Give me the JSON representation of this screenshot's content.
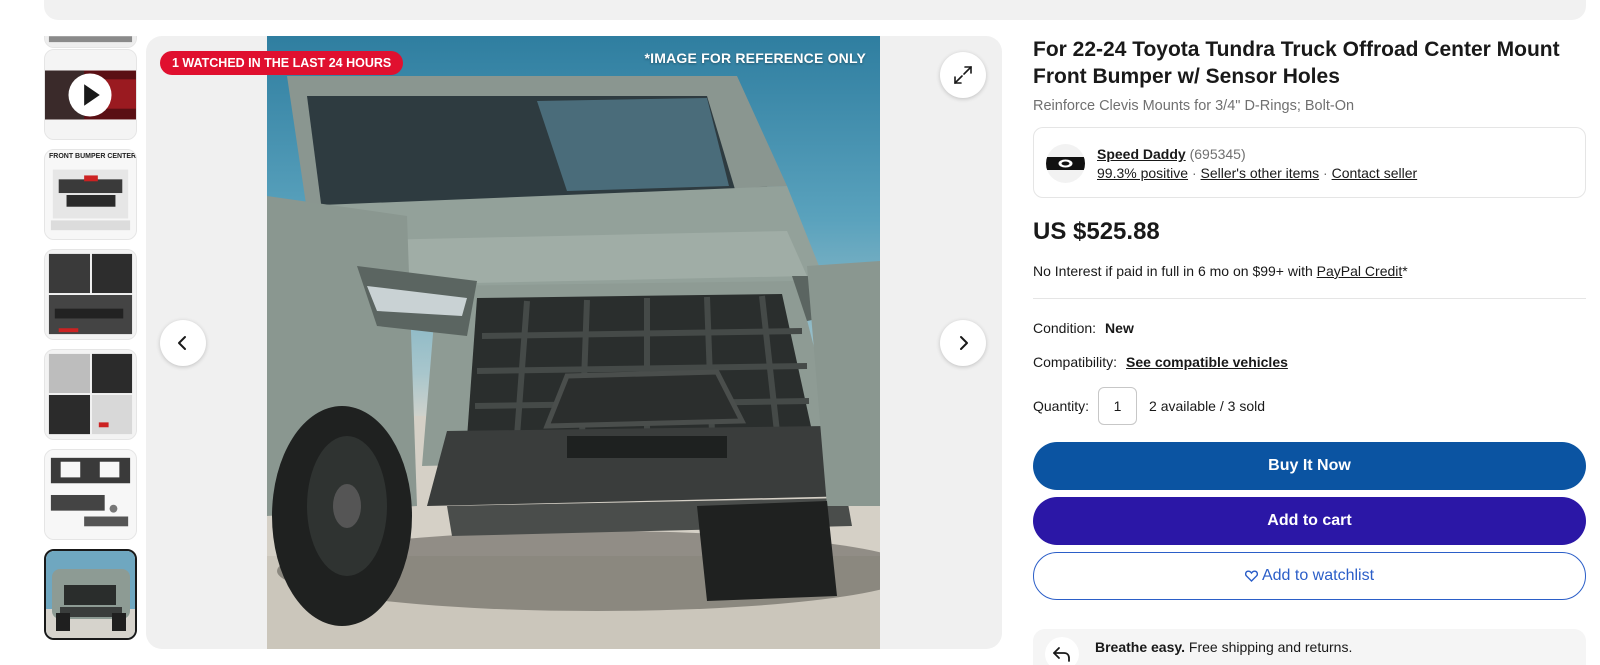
{
  "gallery": {
    "badge": "1 WATCHED IN THE LAST 24 HOURS",
    "watermark": "*IMAGE FOR REFERENCE ONLY",
    "thumbnails": [
      {
        "name": "thumb-partial-top",
        "label": ""
      },
      {
        "name": "thumb-video",
        "label": ""
      },
      {
        "name": "thumb-front-bumper-center",
        "label": "FRONT BUMPER CENTER"
      },
      {
        "name": "thumb-bumper-parts",
        "label": ""
      },
      {
        "name": "thumb-bumper-details",
        "label": ""
      },
      {
        "name": "thumb-bumper-kit",
        "label": ""
      },
      {
        "name": "thumb-truck-front",
        "label": ""
      }
    ]
  },
  "listing": {
    "title": "For 22-24 Toyota Tundra Truck Offroad Center Mount Front Bumper w/ Sensor Holes",
    "subtitle": "Reinforce Clevis Mounts for 3/4\" D-Rings; Bolt-On"
  },
  "seller": {
    "name": "Speed Daddy",
    "feedback_count": "(695345)",
    "positive": "99.3% positive",
    "other_items": "Seller's other items",
    "contact": "Contact seller",
    "separator": "·"
  },
  "pricing": {
    "price": "US $525.88",
    "credit_prefix": "No Interest if paid in full in 6 mo on $99+ with ",
    "credit_link": "PayPal Credit",
    "credit_suffix": "*"
  },
  "details": {
    "condition_label": "Condition:",
    "condition_value": "New",
    "compat_label": "Compatibility:",
    "compat_link": "See compatible vehicles",
    "qty_label": "Quantity:",
    "qty_value": "1",
    "qty_available": "2 available / 3 sold"
  },
  "actions": {
    "buy_now": "Buy It Now",
    "add_to_cart": "Add to cart",
    "watchlist": "Add to watchlist"
  },
  "breathe": {
    "bold": "Breathe easy.",
    "text": " Free shipping and returns."
  },
  "colors": {
    "buy": "#0b54a2",
    "cart": "#2b17a6",
    "badge": "#e0102f"
  }
}
